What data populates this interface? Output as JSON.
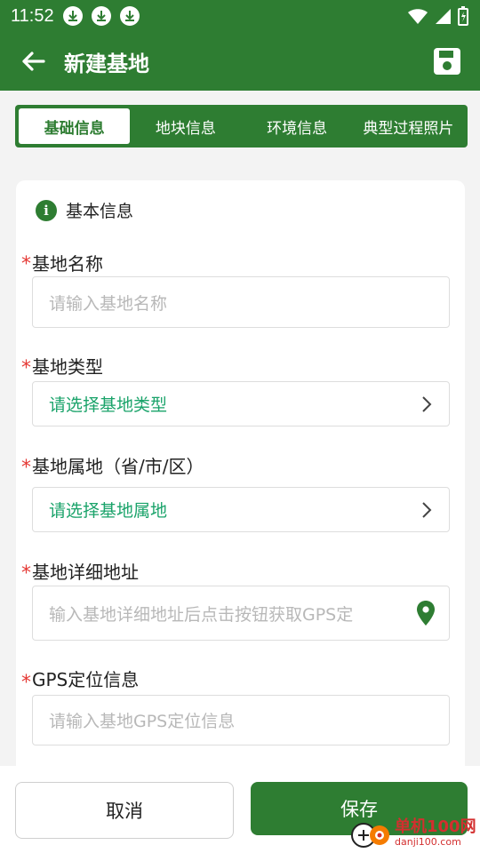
{
  "status_bar": {
    "time": "11:52"
  },
  "app_bar": {
    "title": "新建基地"
  },
  "tabs": [
    {
      "label": "基础信息",
      "active": true
    },
    {
      "label": "地块信息",
      "active": false
    },
    {
      "label": "环境信息",
      "active": false
    },
    {
      "label": "典型过程照片",
      "active": false
    }
  ],
  "section": {
    "title": "基本信息"
  },
  "fields": {
    "name": {
      "label": "基地名称",
      "placeholder": "请输入基地名称",
      "required_mark": "*"
    },
    "type": {
      "label": "基地类型",
      "value": "请选择基地类型",
      "required_mark": "*"
    },
    "region": {
      "label": "基地属地（省/市/区）",
      "value": "请选择基地属地",
      "required_mark": "*"
    },
    "address": {
      "label": "基地详细地址",
      "placeholder": "输入基地详细地址后点击按钮获取GPS定",
      "required_mark": "*"
    },
    "gps": {
      "label": "GPS定位信息",
      "placeholder": "请输入基地GPS定位信息",
      "required_mark": "*"
    }
  },
  "buttons": {
    "cancel": "取消",
    "save": "保存"
  },
  "watermark": {
    "name": "单机100网",
    "url": "danji100.com"
  },
  "colors": {
    "primary": "#2e7d32",
    "accent_text": "#1aa36a",
    "required": "#e53935"
  }
}
